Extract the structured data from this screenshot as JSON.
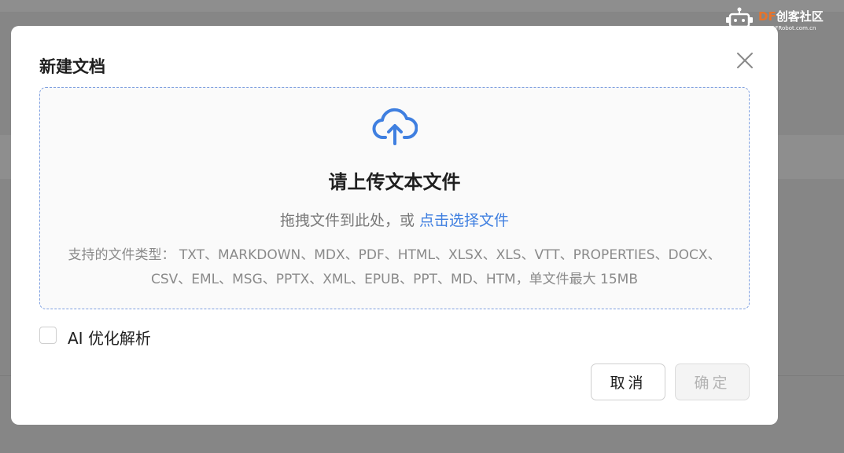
{
  "watermark": {
    "brand_prefix": "DF",
    "brand_suffix": "创客社区",
    "url": "DFRobot.com.cn"
  },
  "dialog": {
    "title": "新建文档",
    "close_icon": "close-icon"
  },
  "dropzone": {
    "icon": "cloud-upload-icon",
    "title": "请上传文本文件",
    "hint_prefix": "拖拽文件到此处，或",
    "hint_link": "点击选择文件",
    "types_line1": "支持的文件类型： TXT、MARKDOWN、MDX、PDF、HTML、XLSX、XLS、VTT、PROPERTIES、DOCX、",
    "types_line2": "CSV、EML、MSG、PPTX、XML、EPUB、PPT、MD、HTM，单文件最大 15MB"
  },
  "options": {
    "ai_parse_label": "AI 优化解析",
    "ai_parse_checked": false
  },
  "buttons": {
    "cancel": "取消",
    "confirm": "确定"
  },
  "colors": {
    "accent": "#3f7fe0",
    "overlay": "#868686"
  }
}
